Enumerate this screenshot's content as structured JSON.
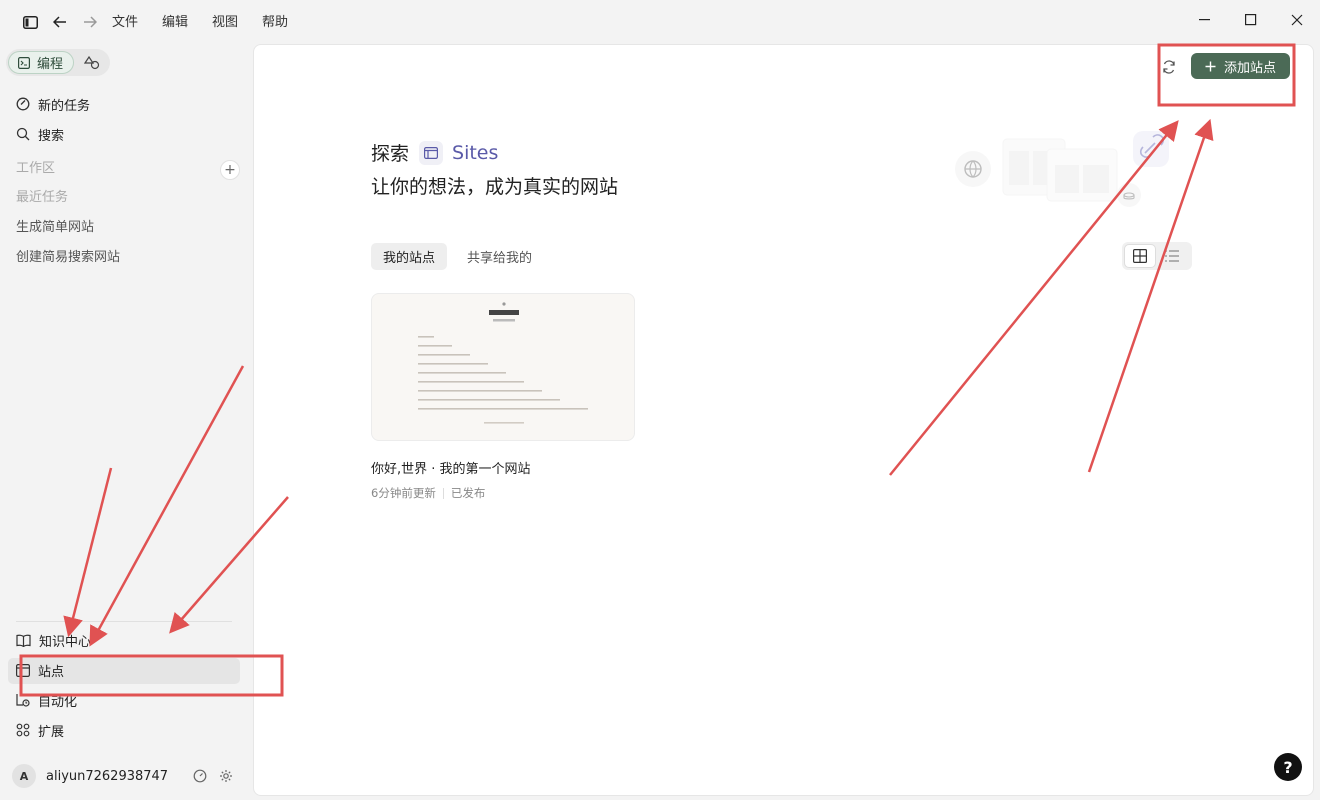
{
  "menu": [
    "文件",
    "编辑",
    "视图",
    "帮助"
  ],
  "sidebar": {
    "mode_active_label": "编程",
    "top_items": [
      {
        "label": "新的任务",
        "icon": "new-task-icon"
      },
      {
        "label": "搜索",
        "icon": "search-icon"
      }
    ],
    "workspace_label": "工作区",
    "recent_label": "最近任务",
    "recent_tasks": [
      "生成简单网站",
      "创建简易搜索网站"
    ],
    "bottom_items": [
      {
        "label": "知识中心",
        "icon": "book-icon"
      },
      {
        "label": "站点",
        "icon": "sites-icon",
        "active": true
      },
      {
        "label": "自动化",
        "icon": "automation-icon"
      },
      {
        "label": "扩展",
        "icon": "extensions-icon"
      }
    ],
    "user": {
      "avatar_letter": "A",
      "name": "aliyun7262938747"
    }
  },
  "main": {
    "add_site_label": "添加站点",
    "hero": {
      "prefix": "探索",
      "product": "Sites",
      "subtitle": "让你的想法，成为真实的网站"
    },
    "tabs": [
      {
        "label": "我的站点",
        "active": true
      },
      {
        "label": "共享给我的",
        "active": false
      }
    ],
    "card": {
      "thumb_title": "九九乘法表",
      "title": "你好,世界 · 我的第一个网站",
      "updated": "6分钟前更新",
      "status": "已发布"
    },
    "help_label": "?"
  },
  "colors": {
    "accent": "#4b6a56",
    "annotation": "#e05252"
  }
}
